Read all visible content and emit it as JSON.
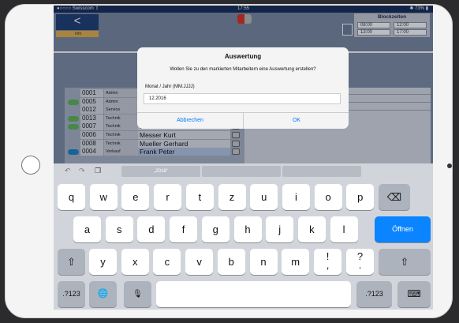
{
  "status": {
    "carrier": "●○○○○ Swisscom ⇪",
    "time": "17:55",
    "battery": "✱ 73% ▮"
  },
  "toolbar": {
    "back": "<",
    "info": "Info"
  },
  "blockzeiten": {
    "title": "Blockzeiten",
    "times": [
      "08:00",
      "12:00",
      "13:00",
      "17:00"
    ]
  },
  "employees": [
    {
      "num": "0001",
      "dept": "Admin",
      "name": "",
      "color": ""
    },
    {
      "num": "0005",
      "dept": "Admin",
      "name": "",
      "color": "#5fb85a"
    },
    {
      "num": "0012",
      "dept": "Service",
      "name": "",
      "color": ""
    },
    {
      "num": "0013",
      "dept": "Technik",
      "name": "",
      "color": "#5fb85a"
    },
    {
      "num": "0007",
      "dept": "Technik",
      "name": "Jost Alfred",
      "color": "#5fb85a"
    },
    {
      "num": "0006",
      "dept": "Technik",
      "name": "Messer Kurt",
      "color": ""
    },
    {
      "num": "0008",
      "dept": "Technik",
      "name": "Mueller Gerhard",
      "color": ""
    },
    {
      "num": "0004",
      "dept": "Verkauf",
      "name": "Frank Peter",
      "color": "#1a86d0"
    }
  ],
  "dialog": {
    "title": "Auswertung",
    "message": "Wollen Sie zu den markierten Mitarbeitern eine Auswertung erstellen?",
    "label": "Monat / Jahr (MM.JJJJ)",
    "value": "12.2016",
    "cancel": "Abbrechen",
    "ok": "OK"
  },
  "keyboard": {
    "suggestion": "„2016“",
    "undo_icon": "undo-icon",
    "redo_icon": "redo-icon",
    "paste_icon": "paste-icon",
    "row1": [
      "q",
      "w",
      "e",
      "r",
      "t",
      "z",
      "u",
      "i",
      "o",
      "p"
    ],
    "row2": [
      "a",
      "s",
      "d",
      "f",
      "g",
      "h",
      "j",
      "k",
      "l"
    ],
    "row3": [
      "y",
      "x",
      "c",
      "v",
      "b",
      "n",
      "m"
    ],
    "exclam": "!\n,",
    "question": "?\n.",
    "delete": "⌫",
    "open": "Öffnen",
    "shift": "⇧",
    "num": ".?123",
    "globe": "🌐",
    "mic": "🎙",
    "hide": "⌨"
  },
  "colors": {
    "status_bar": "#152d58",
    "app_bg": "#7f8ea6",
    "accent": "#0a84ff"
  }
}
